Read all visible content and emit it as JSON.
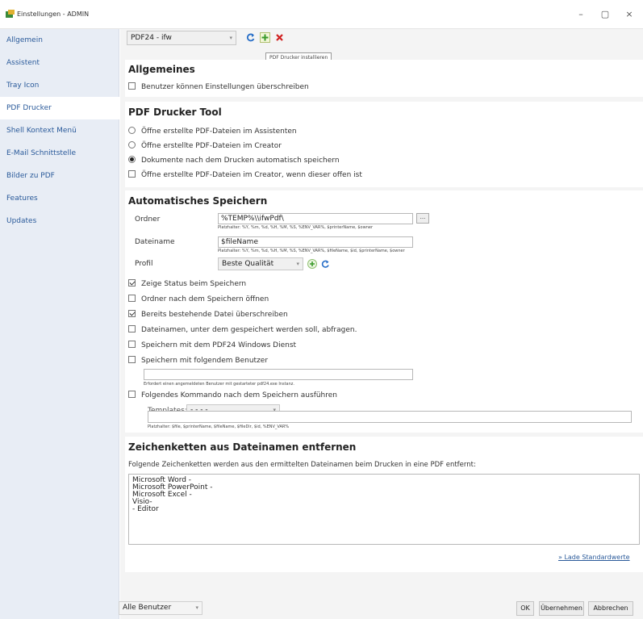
{
  "window": {
    "title": "Einstellungen - ADMIN",
    "controls": {
      "minimize": "–",
      "maximize": "▢",
      "close": "×"
    }
  },
  "sidebar": {
    "items": [
      {
        "label": "Allgemein",
        "active": false
      },
      {
        "label": "Assistent",
        "active": false
      },
      {
        "label": "Tray Icon",
        "active": false
      },
      {
        "label": "PDF Drucker",
        "active": true
      },
      {
        "label": "Shell Kontext Menü",
        "active": false
      },
      {
        "label": "E-Mail Schnittstelle",
        "active": false
      },
      {
        "label": "Bilder zu PDF",
        "active": false
      },
      {
        "label": "Features",
        "active": false
      },
      {
        "label": "Updates",
        "active": false
      }
    ]
  },
  "toolbar": {
    "printer_selected": "PDF24 - ifw",
    "tooltip": "PDF Drucker installieren",
    "icons": [
      "refresh-icon",
      "add-icon",
      "delete-icon"
    ]
  },
  "allgemeines": {
    "title": "Allgemeines",
    "override_label": "Benutzer können Einstellungen überschreiben",
    "override_checked": false
  },
  "pdf_tool": {
    "title": "PDF Drucker Tool",
    "options": [
      {
        "label": "Öffne erstellte PDF-Dateien im Assistenten",
        "type": "radio",
        "checked": false
      },
      {
        "label": "Öffne erstellte PDF-Dateien im Creator",
        "type": "radio",
        "checked": false
      },
      {
        "label": "Dokumente nach dem Drucken automatisch speichern",
        "type": "radio",
        "checked": true
      },
      {
        "label": "Öffne erstellte PDF-Dateien im Creator, wenn dieser offen ist",
        "type": "checkbox",
        "checked": false
      }
    ]
  },
  "auto_save": {
    "title": "Automatisches Speichern",
    "folder_label": "Ordner",
    "folder_value": "%TEMP%\\\\ifwPdf\\",
    "folder_hint": "Platzhalter: %Y, %m, %d, %H, %M, %S, %ENV_VAR%, $printerName, $owner",
    "browse_label": "...",
    "filename_label": "Dateiname",
    "filename_value": "$fileName",
    "filename_hint": "Platzhalter: %Y, %m, %d, %H, %M, %S, %ENV_VAR%, $fileName, $id, $printerName, $owner",
    "profile_label": "Profil",
    "profile_value": "Beste Qualität",
    "options": [
      {
        "label": "Zeige Status beim Speichern",
        "checked": true
      },
      {
        "label": "Ordner nach dem Speichern öffnen",
        "checked": false
      },
      {
        "label": "Bereits bestehende Datei überschreiben",
        "checked": true
      },
      {
        "label": "Dateinamen, unter dem gespeichert werden soll, abfragen.",
        "checked": false
      },
      {
        "label": "Speichern mit dem PDF24 Windows Dienst",
        "checked": false
      },
      {
        "label": "Speichern mit folgendem Benutzer",
        "checked": false
      }
    ],
    "user_value": "",
    "user_hint": "Erfordert einen angemeldeten Benutzer mit gestarteter pdf24.exe Instanz.",
    "command_label": "Folgendes Kommando nach dem Speichern ausführen",
    "command_checked": false,
    "templates_label": "Templates:",
    "templates_value": "- - - -",
    "command_value": "",
    "command_hint": "Platzhalter: $file, $printerName, $fileName, $fileDir, $id, %ENV_VAR%"
  },
  "strip": {
    "title": "Zeichenketten aus Dateinamen entfernen",
    "description": "Folgende Zeichenketten werden aus den ermittelten Dateinamen beim Drucken in eine PDF entfernt:",
    "lines": [
      "Microsoft Word -",
      "Microsoft PowerPoint -",
      "Microsoft Excel -",
      "Visio-",
      " - Editor"
    ],
    "reset_link": "» Lade Standardwerte"
  },
  "footer": {
    "scope_value": "Alle Benutzer",
    "ok_label": "OK",
    "apply_label": "Übernehmen",
    "cancel_label": "Abbrechen"
  },
  "colors": {
    "sidebar_bg": "#e8edf5",
    "link": "#2a5a9a",
    "add_green": "#3a9a2a",
    "delete_red": "#d02020",
    "refresh_blue": "#2a70c8"
  }
}
